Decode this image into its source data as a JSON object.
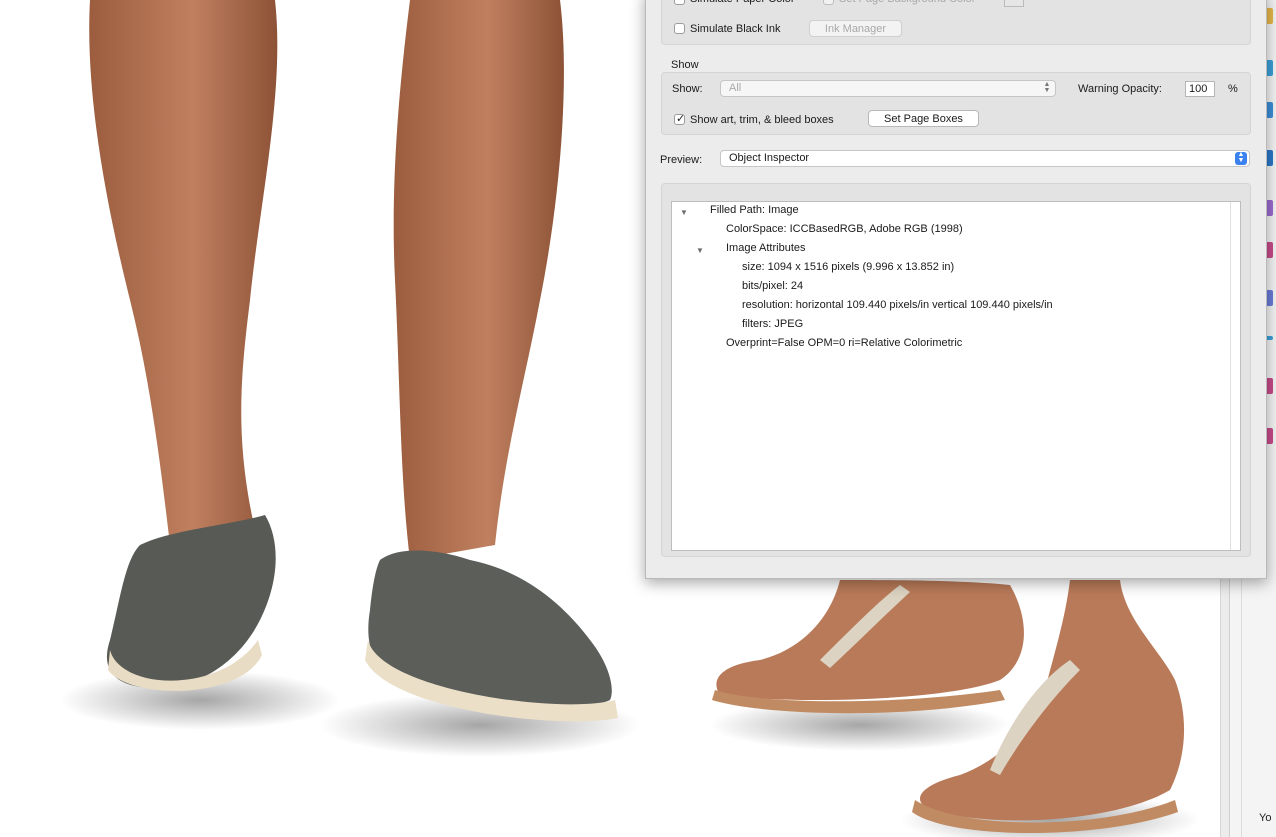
{
  "dialog": {
    "simulate_paper_color": "Simulate Paper Color",
    "set_page_background_color": "Set Page Background Color",
    "simulate_black_ink": "Simulate Black Ink",
    "ink_manager": "Ink Manager",
    "show_group_title": "Show",
    "show_label": "Show:",
    "show_value": "All",
    "warning_opacity_label": "Warning Opacity:",
    "warning_opacity_value": "100",
    "percent": "%",
    "show_boxes_label": "Show art, trim, & bleed boxes",
    "set_page_boxes": "Set Page Boxes",
    "preview_label": "Preview:",
    "preview_value": "Object Inspector"
  },
  "inspector": {
    "filled_path": "Filled Path: Image",
    "colorspace": "ColorSpace: ICCBasedRGB, Adobe RGB (1998)",
    "image_attributes": "Image Attributes",
    "size": "size: 1094 x 1516 pixels (9.996 x 13.852 in)",
    "bits": "bits/pixel: 24",
    "resolution": "resolution: horizontal 109.440 pixels/in vertical 109.440 pixels/in",
    "filters": "filters: JPEG",
    "overprint": "Overprint=False OPM=0 ri=Relative Colorimetric"
  },
  "side": {
    "truncated_text": "Yo"
  },
  "colors": {
    "accent": "#3b82f0",
    "dialog_bg": "#ececec",
    "skin": "#b4714f",
    "shoe": "#5a5c58",
    "sandal": "#c9a27f"
  }
}
